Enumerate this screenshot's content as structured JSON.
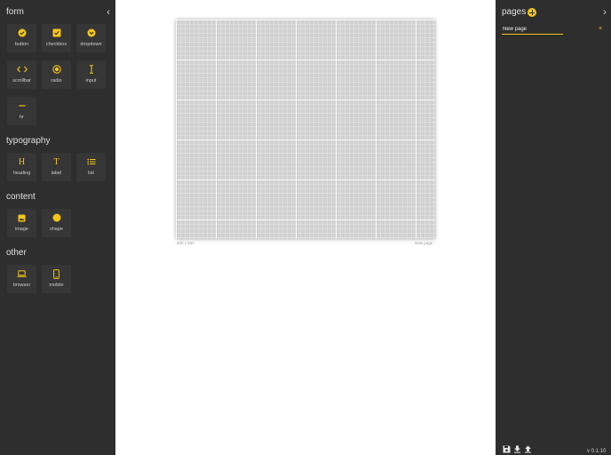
{
  "left_panel": {
    "title": "form",
    "collapse_glyph": "‹",
    "sections": {
      "typography": "typography",
      "content": "content",
      "other": "other"
    },
    "form_items": [
      {
        "label": "button",
        "icon": "check-circle-icon"
      },
      {
        "label": "checkbox",
        "icon": "checkbox-icon"
      },
      {
        "label": "dropdown",
        "icon": "chevron-circle-icon"
      },
      {
        "label": "scrollbar",
        "icon": "code-arrows-icon"
      },
      {
        "label": "radio",
        "icon": "radio-icon"
      },
      {
        "label": "input",
        "icon": "text-cursor-icon"
      },
      {
        "label": "hr",
        "icon": "horizontal-rule-icon"
      }
    ],
    "typography_items": [
      {
        "label": "heading",
        "icon": "heading-icon",
        "glyph": "H"
      },
      {
        "label": "label",
        "icon": "text-icon",
        "glyph": "T"
      },
      {
        "label": "list",
        "icon": "list-icon"
      }
    ],
    "content_items": [
      {
        "label": "image",
        "icon": "image-icon"
      },
      {
        "label": "shape",
        "icon": "circle-shape-icon"
      }
    ],
    "other_items": [
      {
        "label": "browser",
        "icon": "laptop-icon"
      },
      {
        "label": "mobile",
        "icon": "phone-icon"
      }
    ]
  },
  "canvas": {
    "size_label": "600 x 500",
    "page_name_label": "New page"
  },
  "right_panel": {
    "title": "pages",
    "collapse_glyph": "›",
    "page_input_value": "New page",
    "delete_glyph": "×",
    "version": "v 0.1.10"
  },
  "colors": {
    "accent": "#f5c518",
    "panel_bg": "#2e2e2e",
    "tile_bg": "#363636",
    "artboard_bg": "#d1d1d1"
  }
}
